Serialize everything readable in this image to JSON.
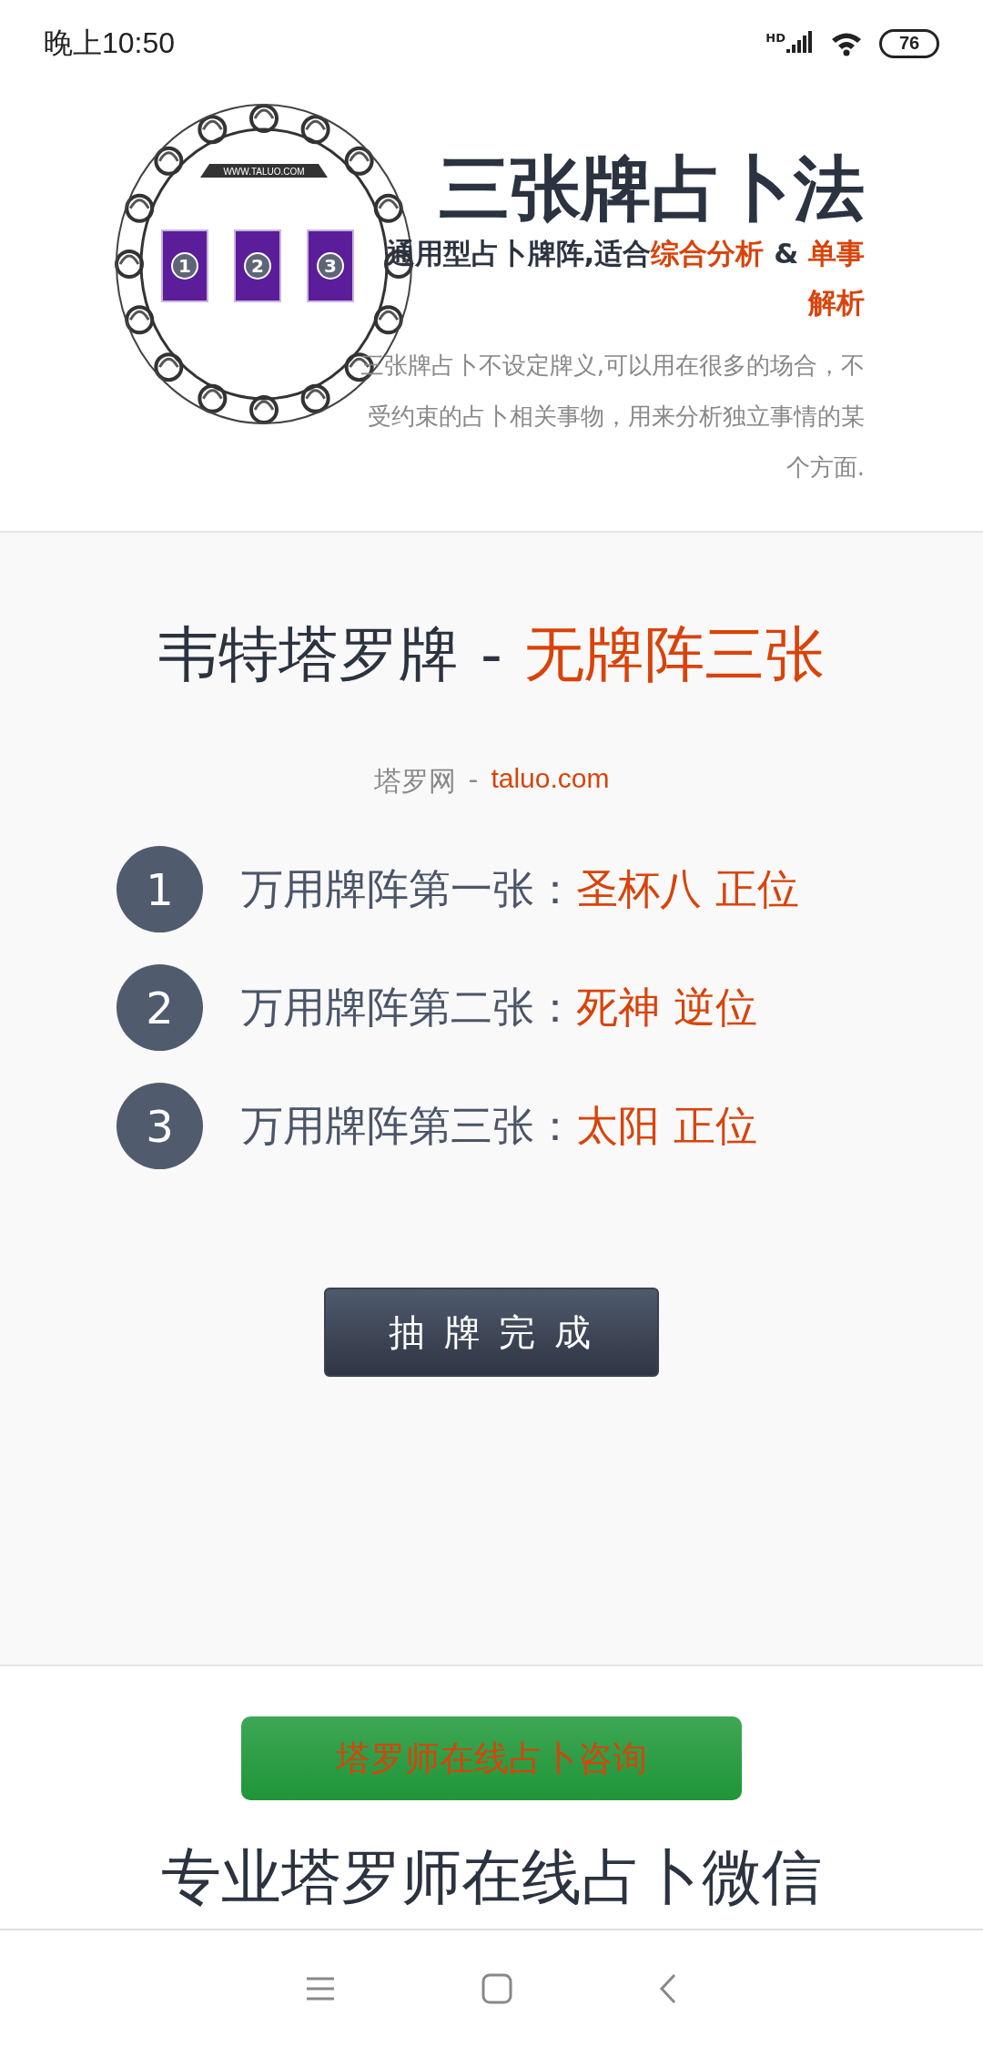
{
  "status_bar": {
    "time": "晚上10:50",
    "network_label": "HD",
    "battery": "76"
  },
  "header": {
    "logo": {
      "ribbon": "WWW.TALUO.COM",
      "cards": [
        "1",
        "2",
        "3"
      ]
    },
    "title": "三张牌占卜法",
    "subtitle": [
      {
        "text": "通用型占卜牌阵,适合",
        "highlight": false
      },
      {
        "text": "综合分析",
        "highlight": true
      },
      {
        "text": " & ",
        "highlight": false
      },
      {
        "text": "单事解析",
        "highlight": true
      }
    ],
    "description": "三张牌占卜不设定牌义,可以用在很多的场合，不受约束的占卜相关事物，用来分析独立事情的某个方面."
  },
  "reading": {
    "heading": [
      {
        "text": "韦特塔罗牌",
        "highlight": false
      },
      {
        "text": " - ",
        "highlight": false
      },
      {
        "text": "无牌阵三张",
        "highlight": true
      }
    ],
    "source": {
      "site": "塔罗网",
      "separator": "-",
      "domain": "taluo.com"
    },
    "cards": [
      {
        "number": "1",
        "label": "万用牌阵第一张：",
        "result": "圣杯八 正位"
      },
      {
        "number": "2",
        "label": "万用牌阵第二张：",
        "result": "死神 逆位"
      },
      {
        "number": "3",
        "label": "万用牌阵第三张：",
        "result": "太阳 正位"
      }
    ],
    "done_button": "抽 牌 完 成"
  },
  "consult_button": "塔罗师在线占卜咨询",
  "next_heading": "专业塔罗师在线占卜微信"
}
